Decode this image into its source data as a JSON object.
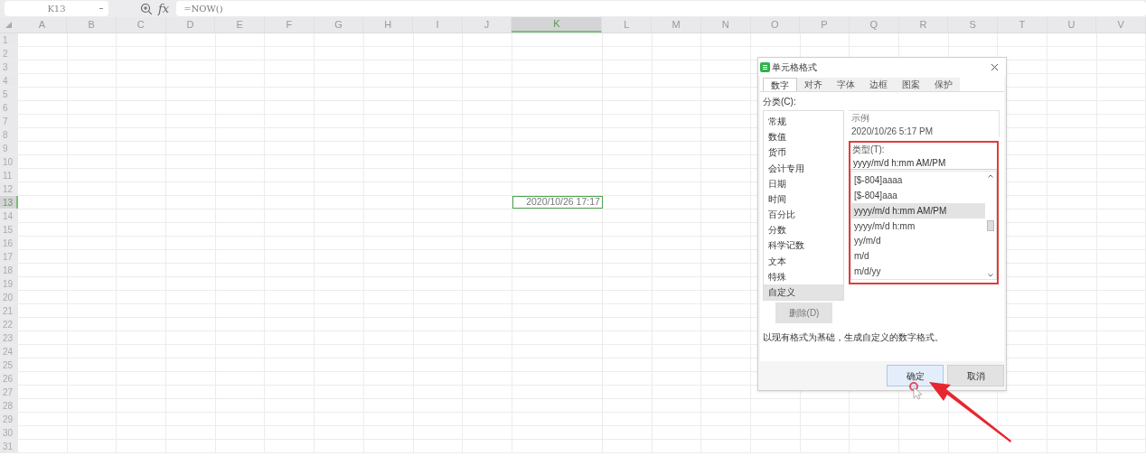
{
  "formula_bar": {
    "name_box": "K13",
    "function_label": "fx",
    "formula": "=NOW()"
  },
  "sheet": {
    "columns": [
      {
        "label": "A",
        "selected": false
      },
      {
        "label": "B",
        "selected": false
      },
      {
        "label": "C",
        "selected": false
      },
      {
        "label": "D",
        "selected": false
      },
      {
        "label": "E",
        "selected": false
      },
      {
        "label": "F",
        "selected": false
      },
      {
        "label": "G",
        "selected": false
      },
      {
        "label": "H",
        "selected": false
      },
      {
        "label": "I",
        "selected": false
      },
      {
        "label": "J",
        "selected": false
      },
      {
        "label": "K",
        "selected": true
      },
      {
        "label": "L",
        "selected": false
      },
      {
        "label": "M",
        "selected": false
      },
      {
        "label": "N",
        "selected": false
      },
      {
        "label": "O",
        "selected": false
      },
      {
        "label": "P",
        "selected": false
      },
      {
        "label": "Q",
        "selected": false
      },
      {
        "label": "R",
        "selected": false
      },
      {
        "label": "S",
        "selected": false
      },
      {
        "label": "T",
        "selected": false
      },
      {
        "label": "U",
        "selected": false
      },
      {
        "label": "V",
        "selected": false
      }
    ],
    "rows": [
      {
        "label": "1",
        "selected": false
      },
      {
        "label": "2",
        "selected": false
      },
      {
        "label": "3",
        "selected": false
      },
      {
        "label": "4",
        "selected": false
      },
      {
        "label": "5",
        "selected": false
      },
      {
        "label": "6",
        "selected": false
      },
      {
        "label": "7",
        "selected": false
      },
      {
        "label": "8",
        "selected": false
      },
      {
        "label": "9",
        "selected": false
      },
      {
        "label": "10",
        "selected": false
      },
      {
        "label": "11",
        "selected": false
      },
      {
        "label": "12",
        "selected": false
      },
      {
        "label": "13",
        "selected": true
      },
      {
        "label": "14",
        "selected": false
      },
      {
        "label": "15",
        "selected": false
      },
      {
        "label": "16",
        "selected": false
      },
      {
        "label": "17",
        "selected": false
      },
      {
        "label": "18",
        "selected": false
      },
      {
        "label": "19",
        "selected": false
      },
      {
        "label": "20",
        "selected": false
      },
      {
        "label": "21",
        "selected": false
      },
      {
        "label": "22",
        "selected": false
      },
      {
        "label": "23",
        "selected": false
      },
      {
        "label": "24",
        "selected": false
      },
      {
        "label": "25",
        "selected": false
      },
      {
        "label": "26",
        "selected": false
      },
      {
        "label": "27",
        "selected": false
      },
      {
        "label": "28",
        "selected": false
      },
      {
        "label": "29",
        "selected": false
      },
      {
        "label": "30",
        "selected": false
      },
      {
        "label": "31",
        "selected": false
      }
    ],
    "active_cell": {
      "value": "2020/10/26 17:17"
    }
  },
  "dialog": {
    "title": "单元格格式",
    "tabs": [
      {
        "label": "数字",
        "selected": true
      },
      {
        "label": "对齐",
        "selected": false
      },
      {
        "label": "字体",
        "selected": false
      },
      {
        "label": "边框",
        "selected": false
      },
      {
        "label": "图案",
        "selected": false
      },
      {
        "label": "保护",
        "selected": false
      }
    ],
    "category_label": "分类(C):",
    "categories": [
      {
        "label": "常规",
        "selected": false
      },
      {
        "label": "数值",
        "selected": false
      },
      {
        "label": "货币",
        "selected": false
      },
      {
        "label": "会计专用",
        "selected": false
      },
      {
        "label": "日期",
        "selected": false
      },
      {
        "label": "时间",
        "selected": false
      },
      {
        "label": "百分比",
        "selected": false
      },
      {
        "label": "分数",
        "selected": false
      },
      {
        "label": "科学记数",
        "selected": false
      },
      {
        "label": "文本",
        "selected": false
      },
      {
        "label": "特殊",
        "selected": false
      },
      {
        "label": "自定义",
        "selected": true
      }
    ],
    "delete_button": {
      "label": "删除(D)",
      "disabled": true
    },
    "sample": {
      "label": "示例",
      "value": "2020/10/26 5:17 PM"
    },
    "type": {
      "label": "类型(T):",
      "value": "yyyy/m/d h:mm AM/PM",
      "options": [
        {
          "label": "[$-804]aaaa",
          "selected": false
        },
        {
          "label": "[$-804]aaa",
          "selected": false
        },
        {
          "label": "yyyy/m/d h:mm AM/PM",
          "selected": true
        },
        {
          "label": "yyyy/m/d h:mm",
          "selected": false
        },
        {
          "label": "yy/m/d",
          "selected": false
        },
        {
          "label": "m/d",
          "selected": false
        },
        {
          "label": "m/d/yy",
          "selected": false
        }
      ]
    },
    "description": "以现有格式为基础，生成自定义的数字格式。",
    "buttons": [
      {
        "label": "确定",
        "kind": "primary"
      },
      {
        "label": "取消",
        "kind": "secondary"
      }
    ]
  }
}
